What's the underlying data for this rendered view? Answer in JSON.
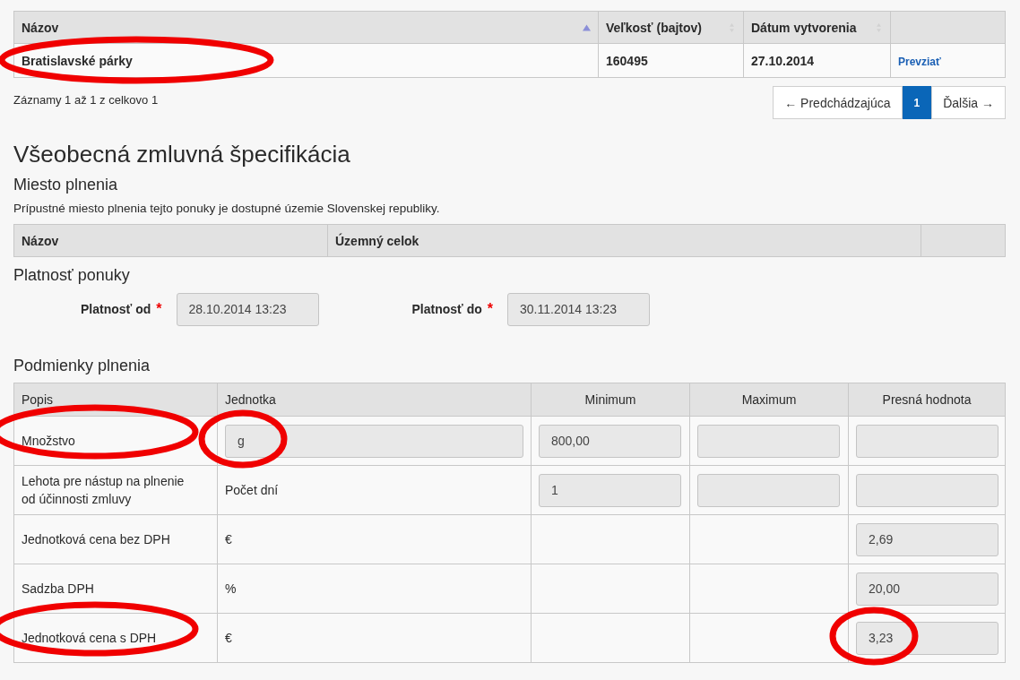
{
  "files_table": {
    "columns": [
      {
        "label": "Názov",
        "sorted": true
      },
      {
        "label": "Veľkosť (bajtov)",
        "sorted": false
      },
      {
        "label": "Dátum vytvorenia",
        "sorted": false
      }
    ],
    "rows": [
      {
        "name": "Bratislavské párky",
        "name_circled": true,
        "size": "160495",
        "date": "27.10.2014",
        "action": "Prevziať"
      }
    ]
  },
  "records_info": "Záznamy 1 až 1 z celkovo 1",
  "pagination": {
    "prev": "← Predchádzajúca",
    "pages": [
      {
        "label": "1",
        "selected": true
      }
    ],
    "next": "Ďalšia →"
  },
  "title": "Všeobecná zmluvná špecifikácia",
  "place": {
    "heading": "Miesto plnenia",
    "text": "Prípustné miesto plnenia tejto ponuky je dostupné územie Slovenskej republiky.",
    "columns": [
      "Názov",
      "Územný celok"
    ]
  },
  "validity": {
    "heading": "Platnosť ponuky",
    "fields": [
      {
        "label": "Platnosť od",
        "required_mark": "*",
        "value": "28.10.2014 13:23"
      },
      {
        "label": "Platnosť do",
        "required_mark": "*",
        "value": "30.11.2014 13:23"
      }
    ]
  },
  "conditions": {
    "heading": "Podmienky plnenia",
    "columns": [
      "Popis",
      "Jednotka",
      "Minimum",
      "Maximum",
      "Presná hodnota"
    ],
    "rows": [
      {
        "popis": "Množstvo",
        "circled": true,
        "unit": {
          "kind": "field",
          "value": "g",
          "circled": true
        },
        "min": {
          "kind": "field",
          "value": "800,00"
        },
        "max": {
          "kind": "field"
        },
        "exact": {
          "kind": "field"
        }
      },
      {
        "popis": "Lehota pre nástup na plnenie od účinnosti zmluvy",
        "circled": false,
        "unit": {
          "kind": "text",
          "value": "Počet dní"
        },
        "min": {
          "kind": "field",
          "value": "1"
        },
        "max": {
          "kind": "field"
        },
        "exact": {
          "kind": "field"
        }
      },
      {
        "popis": "Jednotková cena bez DPH",
        "circled": false,
        "unit": {
          "kind": "text",
          "value": "€"
        },
        "min": {
          "kind": "none"
        },
        "max": {
          "kind": "none"
        },
        "exact": {
          "kind": "field",
          "value": "2,69"
        }
      },
      {
        "popis": "Sadzba DPH",
        "circled": false,
        "unit": {
          "kind": "text",
          "value": "%"
        },
        "min": {
          "kind": "none"
        },
        "max": {
          "kind": "none"
        },
        "exact": {
          "kind": "field",
          "value": "20,00"
        }
      },
      {
        "popis": "Jednotková cena s DPH",
        "circled": true,
        "unit": {
          "kind": "text",
          "value": "€"
        },
        "min": {
          "kind": "none"
        },
        "max": {
          "kind": "none"
        },
        "exact": {
          "kind": "field",
          "value": "3,23",
          "circled": true
        }
      }
    ]
  }
}
